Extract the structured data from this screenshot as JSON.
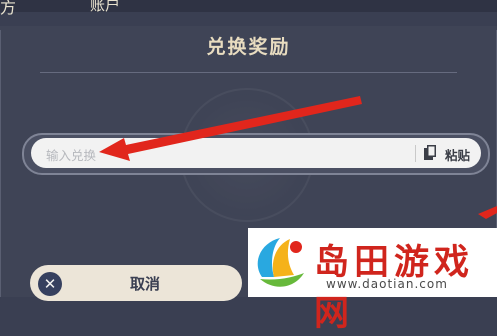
{
  "header": {
    "left_fragment": "方",
    "account_tab": "账户"
  },
  "dialog": {
    "title": "兑换奖励",
    "input": {
      "placeholder": "输入兑换码",
      "visible_placeholder": "输入兑换"
    },
    "paste_label": "粘贴",
    "cancel_label": "取消"
  },
  "watermark": {
    "brand": "岛田游戏网",
    "url": "www.daotian.com"
  },
  "colors": {
    "background": "#3f4456",
    "title": "#e8dcc0",
    "input_bg": "#f2f2f2",
    "button_bg": "#ece5d8",
    "cancel_icon_bg": "#36405f",
    "annotation_red": "#e1261c",
    "brand_red": "#d0251d"
  },
  "icons": {
    "paste": "clipboard-icon",
    "cancel": "close-icon",
    "arrow": "annotation-arrow"
  }
}
